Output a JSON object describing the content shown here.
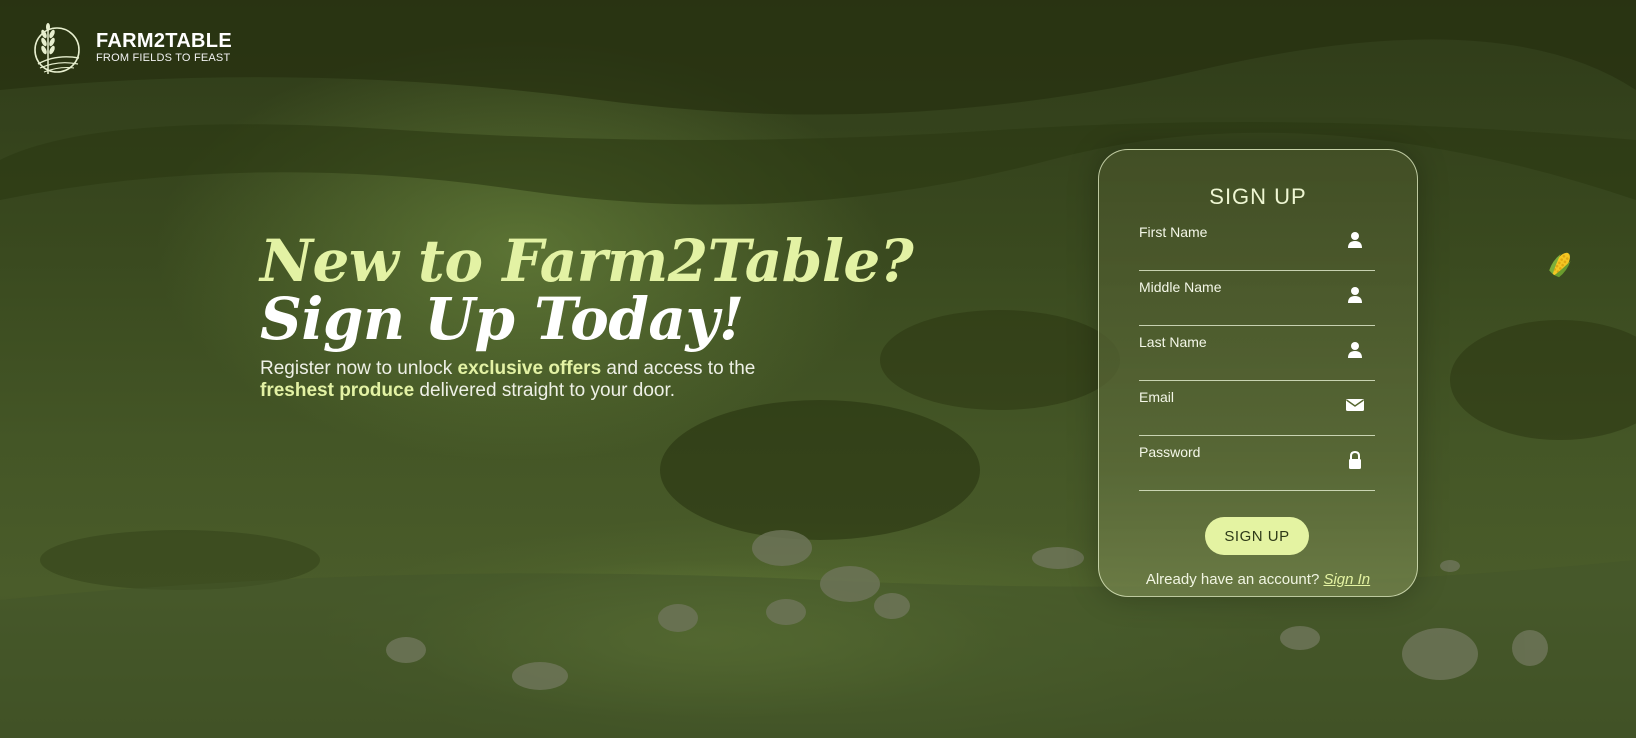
{
  "brand": {
    "name": "FARM2TABLE",
    "tagline": "FROM FIELDS TO FEAST"
  },
  "hero": {
    "line1": "New to Farm2Table?",
    "line2": "Sign Up Today!",
    "sub_part1": "Register now to unlock ",
    "sub_bold1": "exclusive offers",
    "sub_part2": " and access to the ",
    "sub_bold2": "freshest produce",
    "sub_part3": " delivered straight to your door."
  },
  "form": {
    "title": "SIGN UP",
    "fields": [
      {
        "label": "First Name",
        "value": "",
        "icon": "user-icon"
      },
      {
        "label": "Middle Name",
        "value": "",
        "icon": "user-icon"
      },
      {
        "label": "Last Name",
        "value": "",
        "icon": "user-icon"
      },
      {
        "label": "Email",
        "value": "",
        "icon": "envelope-icon"
      },
      {
        "label": "Password",
        "value": "",
        "icon": "lock-icon"
      }
    ],
    "submit_label": "SIGN UP",
    "signin_prompt": "Already have an account? ",
    "signin_link": "Sign In"
  },
  "colors": {
    "accent": "#e4f3a2",
    "background": "#3a4a1f"
  },
  "decor": {
    "corner_icon": "corn-icon"
  }
}
